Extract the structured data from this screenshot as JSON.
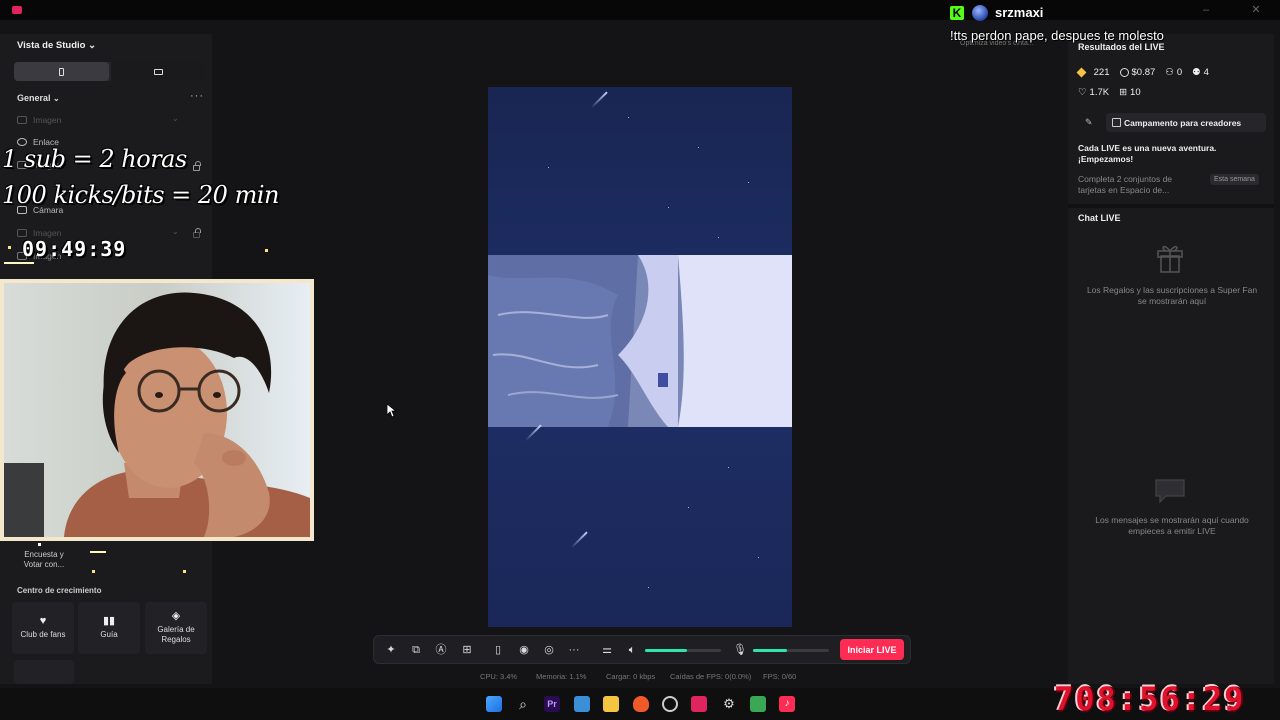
{
  "left_panel": {
    "studio_title": "Vista de Studio",
    "section_general": "General",
    "sources": [
      {
        "label": "Imagen"
      },
      {
        "label": "Enlace"
      },
      {
        "label": "Imagen"
      },
      {
        "label": "Cámara"
      },
      {
        "label": "Imagen"
      },
      {
        "label": "Imagen"
      }
    ],
    "poll_label": "Encuesta y Votar con...",
    "growth_title": "Centro de crecimiento",
    "growth_items": [
      {
        "label": "Club de fans"
      },
      {
        "label": "Guía"
      },
      {
        "label": "Galería de Regalos"
      }
    ]
  },
  "overlay": {
    "line1": "1 sub = 2 horas",
    "line2": "100 kicks/bits = 20 min",
    "timer_small": "09:49:39",
    "timer_big": "708:56:29"
  },
  "stream_chat": {
    "username": "srzmaxi",
    "message": "!tts perdon pape, despues te molesto",
    "ghost": "Optimiza video's cinta..."
  },
  "toolbar": {
    "live_button": "Iniciar LIVE",
    "cpu": "CPU: 3.4%",
    "memory": "Memoria: 1.1%",
    "upload": "Cargar: 0 kbps",
    "fps_drops": "Caídas de FPS: 0(0.0%)",
    "fps": "FPS: 0/60",
    "speaker_level": 0.55,
    "mic_level": 0.45
  },
  "right_panel": {
    "results_title": "Resultados del LIVE",
    "stats": {
      "diamonds": "221",
      "earnings": "$0.87",
      "viewers": "0",
      "new_followers": "4",
      "likes": "1.7K",
      "gifts": "10"
    },
    "campaign_button": "Campamento para creadores",
    "adventure_line1": "Cada LIVE es una nueva aventura.",
    "adventure_line2": "¡Empezamos!",
    "task_text": "Completa 2 conjuntos de tarjetas en Espacio de...",
    "week_badge": "Esta semana",
    "chat_title": "Chat LIVE",
    "gifts_msg": "Los Regalos y las suscripciones a Super Fan se mostrarán aquí",
    "messages_msg": "Los mensajes se mostrarán aquí cuando empieces a emitir LIVE"
  },
  "colors": {
    "accent_live": "#fe2c55",
    "slider_fill": "#2ee6a8",
    "timer_red": "#e0112b"
  }
}
